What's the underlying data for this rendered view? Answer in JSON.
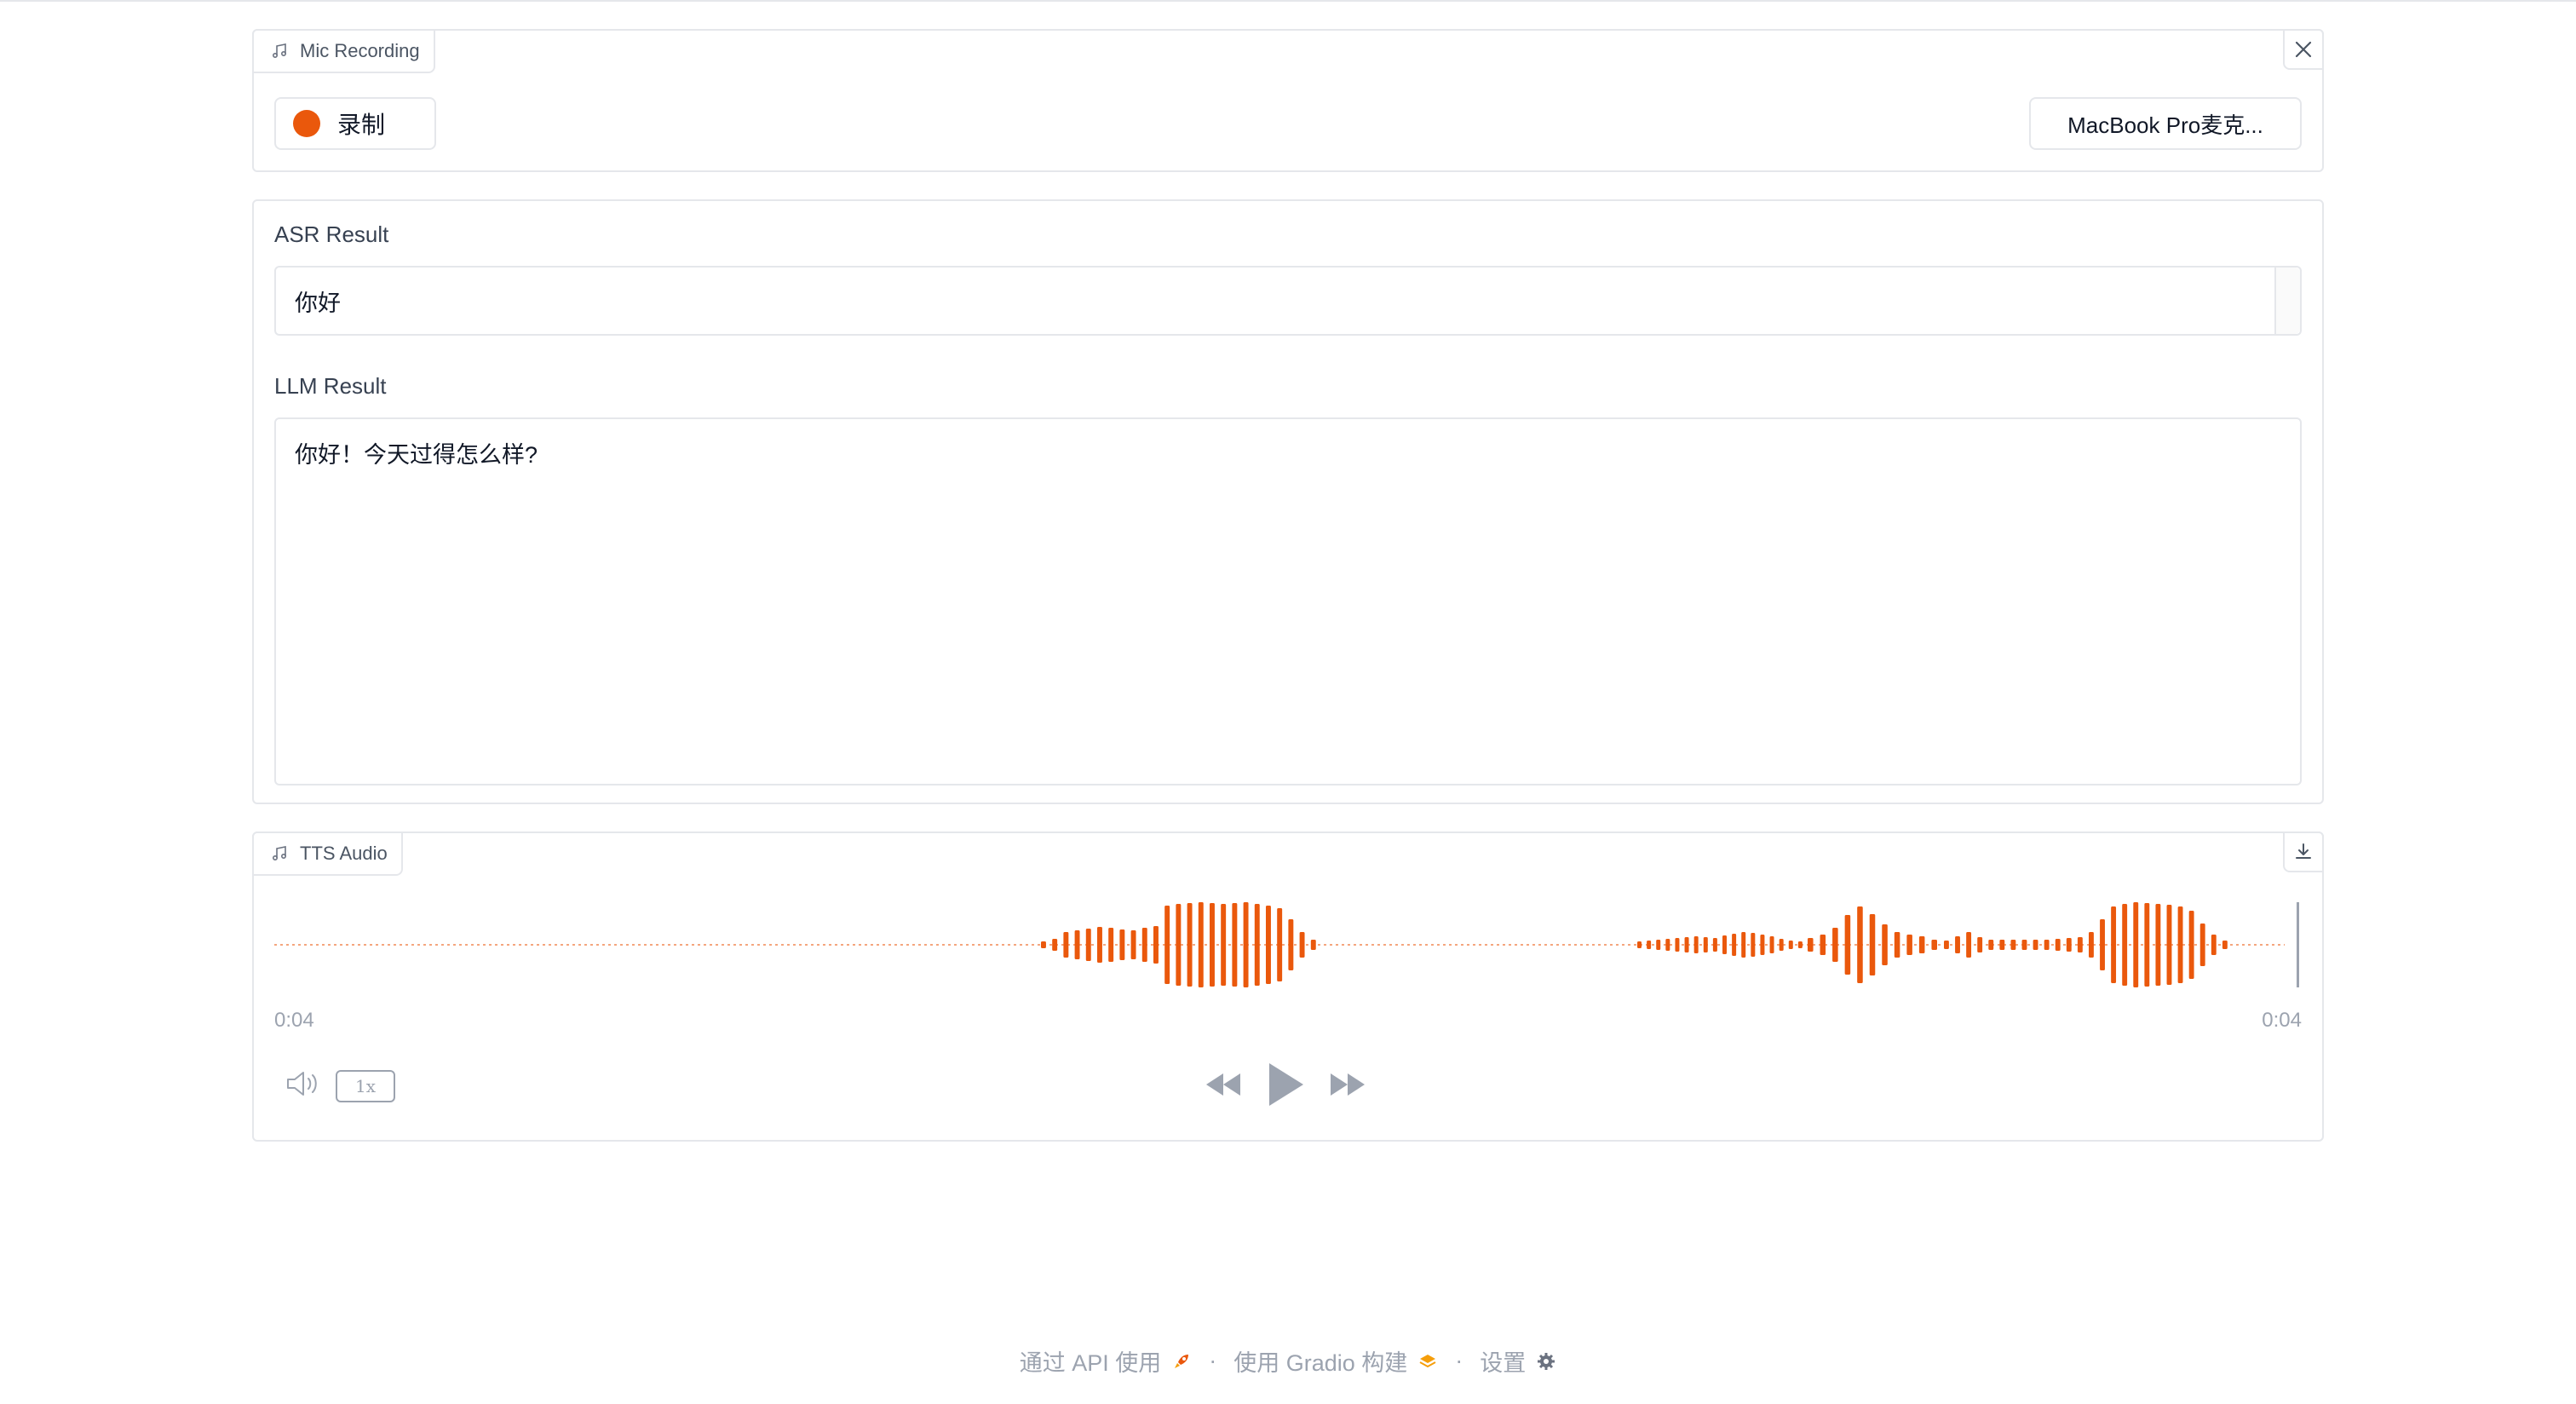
{
  "mic": {
    "label": "Mic Recording",
    "record_label": "录制",
    "device": "MacBook Pro麦克..."
  },
  "asr": {
    "label": "ASR Result",
    "value": "你好"
  },
  "llm": {
    "label": "LLM Result",
    "value": "你好！今天过得怎么样?"
  },
  "tts": {
    "label": "TTS Audio",
    "time_current": "0:04",
    "time_total": "0:04",
    "speed": "1x"
  },
  "footer": {
    "api": "通过 API 使用",
    "built": "使用 Gradio 构建",
    "settings": "设置"
  },
  "colors": {
    "accent": "#ea580c",
    "border": "#e5e7eb",
    "muted": "#9ca3af"
  },
  "icons": {
    "label": "music-note-icon",
    "close": "close-icon",
    "download": "download-icon",
    "volume": "volume-icon",
    "rewind": "rewind-icon",
    "play": "play-icon",
    "forward": "fast-forward-icon",
    "api": "rocket-icon",
    "gradio": "gradio-logo-icon",
    "settings": "gear-icon"
  }
}
